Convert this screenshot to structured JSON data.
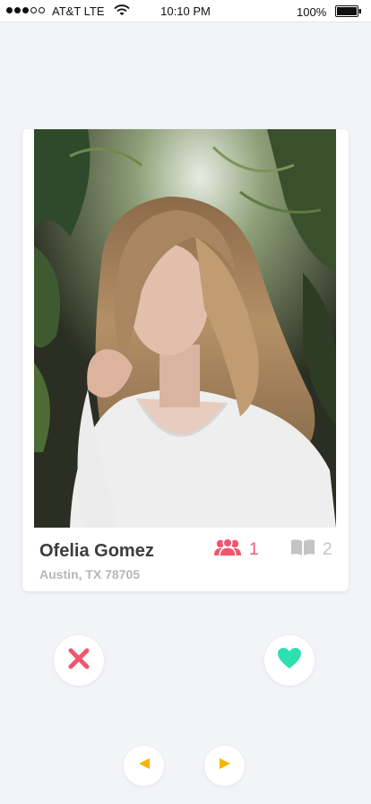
{
  "status_bar": {
    "carrier": "AT&T LTE",
    "time": "10:10 PM",
    "battery": "100%"
  },
  "profile": {
    "name": "Ofelia Gomez",
    "location": "Austin, TX 78705",
    "mutual_friends_count": "1",
    "interests_count": "2"
  },
  "colors": {
    "accent_pink": "#f2556e",
    "accent_teal": "#2ee0b0",
    "arrow_yellow": "#f5b400",
    "muted_gray": "#c4c4c4"
  },
  "icons": {
    "dislike": "close-icon",
    "like": "heart-icon",
    "previous": "arrow-left-icon",
    "next": "arrow-right-icon",
    "friends": "users-icon",
    "interests": "book-icon"
  }
}
